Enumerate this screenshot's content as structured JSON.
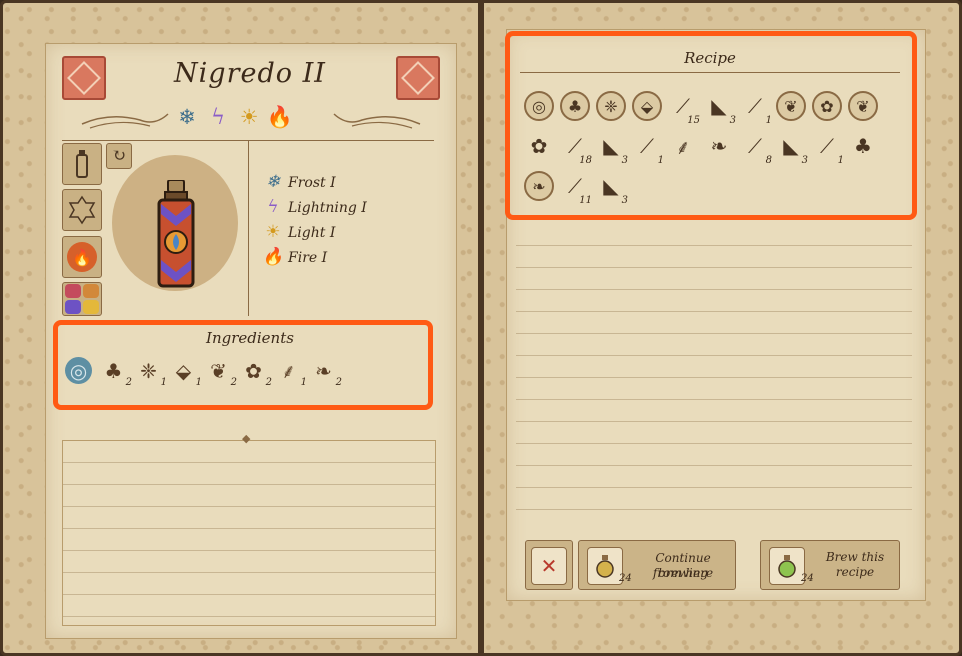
{
  "potion": {
    "name": "Nigredo II",
    "header_effects": [
      "frost-icon",
      "lightning-icon",
      "light-icon",
      "fire-icon"
    ]
  },
  "effects": [
    {
      "icon": "frost-icon",
      "glyph": "❄",
      "color": "#3f6f8c",
      "label": "Frost I"
    },
    {
      "icon": "lightning-icon",
      "glyph": "ϟ",
      "color": "#8a5cc7",
      "label": "Lightning I"
    },
    {
      "icon": "light-icon",
      "glyph": "☀",
      "color": "#d49a1e",
      "label": "Light I"
    },
    {
      "icon": "fire-icon",
      "glyph": "🔥",
      "color": "#d6602a",
      "label": "Fire I"
    }
  ],
  "ingredients_title": "Ingredients",
  "ingredients": [
    {
      "name": "sphere-ingredient-icon",
      "glyph": "◎",
      "count": ""
    },
    {
      "name": "mushroom-ingredient-icon",
      "glyph": "♣",
      "count": "2"
    },
    {
      "name": "crystal-cluster-ingredient-icon",
      "glyph": "❈",
      "count": "1"
    },
    {
      "name": "crystal-ingredient-icon",
      "glyph": "⬙",
      "count": "1"
    },
    {
      "name": "flower-bud-ingredient-icon",
      "glyph": "❦",
      "count": "2"
    },
    {
      "name": "leaf-ingredient-icon",
      "glyph": "✿",
      "count": "2"
    },
    {
      "name": "root-ingredient-icon",
      "glyph": "⸙",
      "count": "1"
    },
    {
      "name": "fire-flower-ingredient-icon",
      "glyph": "❧",
      "count": "2"
    }
  ],
  "recipe_title": "Recipe",
  "recipe_rows": [
    [
      {
        "name": "sphere-step-icon",
        "glyph": "◎",
        "circle": true,
        "count": ""
      },
      {
        "name": "mushroom-step-icon",
        "glyph": "♣",
        "circle": true,
        "count": ""
      },
      {
        "name": "crystal-cluster-step-icon",
        "glyph": "❈",
        "circle": true,
        "count": ""
      },
      {
        "name": "crystal-step-icon",
        "glyph": "⬙",
        "circle": true,
        "count": ""
      },
      {
        "name": "stir-spoon-icon",
        "glyph": "⟋",
        "circle": false,
        "count": "15"
      },
      {
        "name": "pour-ladle-icon",
        "glyph": "◣",
        "circle": false,
        "count": "3"
      },
      {
        "name": "stir-spoon-icon",
        "glyph": "⟋",
        "circle": false,
        "count": "1"
      },
      {
        "name": "flower-bud-step-icon",
        "glyph": "❦",
        "circle": true,
        "count": ""
      },
      {
        "name": "leaf-step-icon",
        "glyph": "✿",
        "circle": true,
        "count": ""
      },
      {
        "name": "flower-bud-step-icon",
        "glyph": "❦",
        "circle": true,
        "count": ""
      }
    ],
    [
      {
        "name": "leaf-step-icon",
        "glyph": "✿",
        "circle": false,
        "count": ""
      },
      {
        "name": "stir-spoon-icon",
        "glyph": "⟋",
        "circle": false,
        "count": "18"
      },
      {
        "name": "pour-ladle-icon",
        "glyph": "◣",
        "circle": false,
        "count": "3"
      },
      {
        "name": "stir-spoon-icon",
        "glyph": "⟋",
        "circle": false,
        "count": "1"
      },
      {
        "name": "root-step-icon",
        "glyph": "⸙",
        "circle": false,
        "count": ""
      },
      {
        "name": "fire-flower-step-icon",
        "glyph": "❧",
        "circle": false,
        "count": ""
      },
      {
        "name": "stir-spoon-icon",
        "glyph": "⟋",
        "circle": false,
        "count": "8"
      },
      {
        "name": "pour-ladle-icon",
        "glyph": "◣",
        "circle": false,
        "count": "3"
      },
      {
        "name": "stir-spoon-icon",
        "glyph": "⟋",
        "circle": false,
        "count": "1"
      },
      {
        "name": "mushroom-step-icon",
        "glyph": "♣",
        "circle": false,
        "count": ""
      }
    ],
    [
      {
        "name": "fire-flower-step-icon",
        "glyph": "❧",
        "circle": true,
        "count": ""
      },
      {
        "name": "stir-spoon-icon",
        "glyph": "⟋",
        "circle": false,
        "count": "11"
      },
      {
        "name": "pour-ladle-icon",
        "glyph": "◣",
        "circle": false,
        "count": "3"
      }
    ]
  ],
  "actions": {
    "discard_glyph": "✕",
    "continue_label_1": "Continue brewing",
    "continue_label_2": "from here",
    "continue_count": "24",
    "brew_label_1": "Brew this",
    "brew_label_2": "recipe",
    "brew_count": "24"
  },
  "colors": {
    "highlight": "#ff5a14",
    "tile": "#d9785f",
    "parchment": "#e9dcbc"
  }
}
